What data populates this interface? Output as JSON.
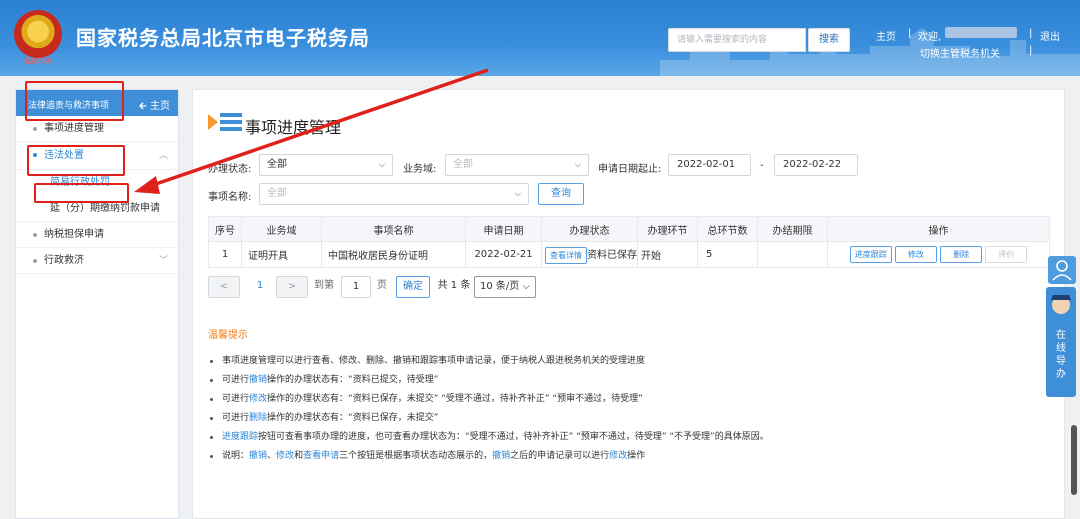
{
  "header": {
    "emblem_caption": "北京税务",
    "title": "国家税务总局北京市电子税务局",
    "search_placeholder": "请输入需要搜索的内容",
    "search_label": "搜索",
    "home_link": "主页",
    "sep1": "|",
    "welcome": "欢迎,",
    "sep2": "|",
    "logout": "退出",
    "switch_org": "切换主管税务机关",
    "sep3": "|"
  },
  "sidebar": {
    "title": "法律追责与救济事项",
    "home": "主页",
    "items": [
      {
        "label": "事项进度管理"
      },
      {
        "label": "违法处置"
      },
      {
        "label": "简易行政处罚"
      },
      {
        "label": "延（分）期缴纳罚款申请"
      },
      {
        "label": "纳税担保申请"
      },
      {
        "label": "行政救济"
      }
    ]
  },
  "main": {
    "title": "事项进度管理",
    "filters": {
      "status_label": "办理状态:",
      "status_value": "全部",
      "business_label": "业务域:",
      "business_placeholder": "全部",
      "date_label": "申请日期起止:",
      "date_from": "2022-02-01",
      "date_sep": "-",
      "date_to": "2022-02-22",
      "name_label": "事项名称:",
      "name_placeholder": "全部",
      "query_label": "查询"
    },
    "table": {
      "headers": [
        "序号",
        "业务域",
        "事项名称",
        "申请日期",
        "办理状态",
        "办理环节",
        "总环节数",
        "办结期限",
        "操作"
      ],
      "rows": [
        {
          "no": "1",
          "domain": "证明开具",
          "name": "中国税收居民身份证明",
          "date": "2022-02-21",
          "status_btn": "查看详情",
          "status": "资料已保存",
          "step": "开始",
          "total": "5",
          "deadline": "",
          "actions": [
            "进度跟踪",
            "修改",
            "删除",
            "评价"
          ]
        }
      ]
    },
    "pager": {
      "prev": "<",
      "page": "1",
      "next": ">",
      "goto_label": "到第",
      "goto_value": "1",
      "page_unit": "页",
      "confirm": "确定",
      "total": "共 1 条",
      "per_page": "10 条/页"
    },
    "tips": {
      "title": "温馨提示",
      "lines": [
        {
          "a": "事项进度管理可以进行查看、修改、删除、撤销和跟踪事项申请记录，便于纳税人跟进税务机关的受理进度"
        },
        {
          "a": "可进行",
          "b": "撤销",
          "c": "操作的办理状态有：“资料已提交，待受理”"
        },
        {
          "a": "可进行",
          "b": "修改",
          "c": "操作的办理状态有：“资料已保存，未提交”  “受理不通过，待补齐补正”  “预审不通过，待受理”"
        },
        {
          "a": "可进行",
          "b": "删除",
          "c": "操作的办理状态有：“资料已保存，未提交”"
        },
        {
          "b": "进度跟踪",
          "c": "按钮可查看事项办理的进度，也可查看办理状态为：“受理不通过，待补齐补正”  “预审不通过，待受理”  “不予受理”的具体原因。"
        },
        {
          "a": "说明：",
          "b1": "撤销",
          "m1": "、",
          "b2": "修改",
          "m2": "和",
          "b3": "查看申请",
          "m3": "三个按钮是根据事项状态动态展示的，",
          "b4": "撤销",
          "m4": "之后的申请记录可以进行",
          "b5": "修改",
          "m5": "操作"
        }
      ]
    }
  },
  "float_panel": {
    "label": "在线导办"
  },
  "colors": {
    "header": "#2b7fd2",
    "accent": "#2d86d6",
    "tips_title": "#ef7d1a",
    "annotation": "#e0201b"
  }
}
